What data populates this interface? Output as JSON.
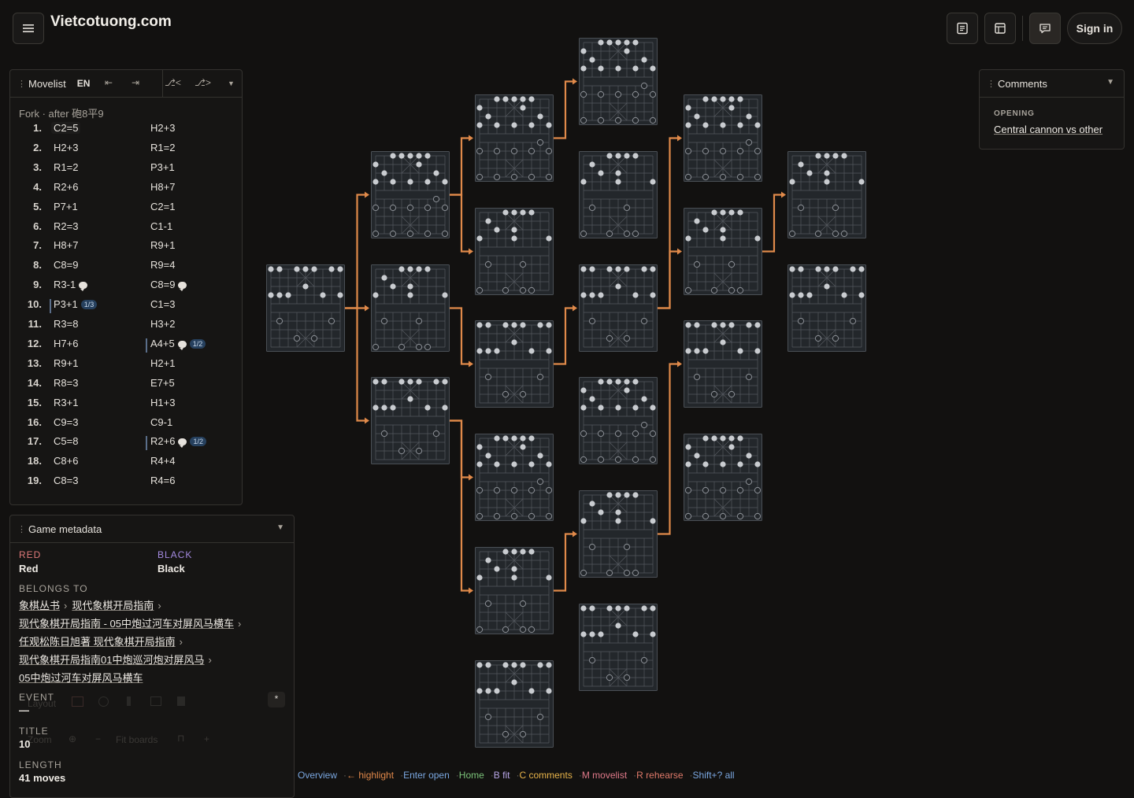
{
  "header": {
    "site_title": "Vietcotuong.com",
    "sign_in_label": "Sign in"
  },
  "movelist": {
    "title": "Movelist",
    "lang": "EN",
    "fork_label": "Fork · after 砲8平9",
    "moves": [
      {
        "num": "1.",
        "red": "C2=5",
        "black": "H2+3"
      },
      {
        "num": "2.",
        "red": "H2+3",
        "black": "R1=2"
      },
      {
        "num": "3.",
        "red": "R1=2",
        "black": "P3+1"
      },
      {
        "num": "4.",
        "red": "R2+6",
        "black": "H8+7"
      },
      {
        "num": "5.",
        "red": "P7+1",
        "black": "C2=1"
      },
      {
        "num": "6.",
        "red": "R2=3",
        "black": "C1-1"
      },
      {
        "num": "7.",
        "red": "H8+7",
        "black": "R9+1"
      },
      {
        "num": "8.",
        "red": "C8=9",
        "black": "R9=4"
      },
      {
        "num": "9.",
        "red": "R3-1",
        "black": "C8=9"
      },
      {
        "num": "10.",
        "red": "P3+1",
        "black": "C1=3"
      },
      {
        "num": "11.",
        "red": "R3=8",
        "black": "H3+2"
      },
      {
        "num": "12.",
        "red": "H7+6",
        "black": "A4+5"
      },
      {
        "num": "13.",
        "red": "R9+1",
        "black": "H2+1"
      },
      {
        "num": "14.",
        "red": "R8=3",
        "black": "E7+5"
      },
      {
        "num": "15.",
        "red": "R3+1",
        "black": "H1+3"
      },
      {
        "num": "16.",
        "red": "C9=3",
        "black": "C9-1"
      },
      {
        "num": "17.",
        "red": "C5=8",
        "black": "R2+6"
      },
      {
        "num": "18.",
        "red": "C8+6",
        "black": "R4+4"
      },
      {
        "num": "19.",
        "red": "C8=3",
        "black": "R4=6"
      }
    ],
    "badges": {
      "m10_red": "1/3",
      "m12_black": "1/2",
      "m17_black": "1/2"
    }
  },
  "meta": {
    "title": "Game metadata",
    "red_label": "RED",
    "red_value": "Red",
    "black_label": "BLACK",
    "black_value": "Black",
    "belongs_label": "BELONGS TO",
    "crumbs": [
      "象棋丛书",
      "现代象棋开局指南",
      "现代象棋开局指南 - 05中炮过河车对屏风马横车",
      "任观松陈日旭著 现代象棋开局指南",
      "现代象棋开局指南01中炮巡河炮对屏风马",
      "05中炮过河车对屏风马横车"
    ],
    "event_label": "EVENT",
    "event_value": "—",
    "title_label": "TITLE",
    "title_value": "10",
    "length_label": "LENGTH",
    "length_value": "41 moves",
    "ghost_layout": "Layout",
    "ghost_zoom": "Zoom",
    "ghost_fit": "Fit boards",
    "ghost_star": "*"
  },
  "comments": {
    "title": "Comments",
    "opening_label": "OPENING",
    "opening_value": "Central cannon vs other"
  },
  "footer": {
    "items": [
      {
        "text": "Overview",
        "color": "#7aa7e0"
      },
      {
        "text": "← highlight",
        "color": "#e0884a"
      },
      {
        "text": "Enter open",
        "color": "#7aa7e0"
      },
      {
        "text": "Home",
        "color": "#7cc47a"
      },
      {
        "text": "B fit",
        "color": "#b9a7e8"
      },
      {
        "text": "C comments",
        "color": "#e8b44a"
      },
      {
        "text": "M movelist",
        "color": "#e07a8a"
      },
      {
        "text": "R rehearse",
        "color": "#e07a6a"
      },
      {
        "text": "Shift+? all",
        "color": "#7aa7e0"
      }
    ]
  },
  "colors": {
    "accent": "#e08a4a",
    "red_label": "#e07a7a",
    "black_label": "#a48ae0"
  },
  "icons": [
    "menu-icon",
    "notes-icon",
    "layout-icon",
    "comment-icon",
    "first-move-icon",
    "last-move-icon",
    "branch-prev-icon",
    "branch-next-icon",
    "chevron-down-icon"
  ]
}
